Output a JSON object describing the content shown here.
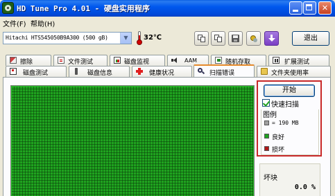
{
  "window": {
    "title": "HD Tune Pro 4.01 - 硬盘实用程序",
    "minimize_label": "_",
    "maximize_label": "□",
    "close_label": "✕"
  },
  "menu": {
    "items": [
      {
        "label": "文件(F)"
      },
      {
        "label": "帮助(H)"
      }
    ]
  },
  "toolbar": {
    "drive": "Hitachi HTS545050B9A300 (500 gB)",
    "temperature": "32℃",
    "exit_label": "退出",
    "buttons": [
      "copy-text-icon",
      "copy-screenshot-icon",
      "save-icon",
      "options-icon",
      "download-icon"
    ]
  },
  "tabs": {
    "row1": [
      {
        "label": "擦除",
        "icon": "erase-icon"
      },
      {
        "label": "文件测试",
        "icon": "file-test-icon"
      },
      {
        "label": "磁盘监视",
        "icon": "disk-monitor-icon"
      },
      {
        "label": "AAM",
        "icon": "speaker-icon"
      },
      {
        "label": "随机存取",
        "icon": "random-access-icon"
      },
      {
        "label": "扩展测试",
        "icon": "extra-tests-icon"
      }
    ],
    "row2": [
      {
        "label": "磁盘测试",
        "icon": "benchmark-icon"
      },
      {
        "label": "磁盘信息",
        "icon": "info-icon"
      },
      {
        "label": "健康状况",
        "icon": "health-cross-icon"
      },
      {
        "label": "扫描错误",
        "icon": "magnifier-icon",
        "active": true
      },
      {
        "label": "文件夹使用率",
        "icon": "folder-icon"
      }
    ]
  },
  "scan": {
    "start_label": "开始",
    "quick_scan_label": "快速扫描",
    "quick_scan_checked": true,
    "legend_title": "图例",
    "legend": [
      {
        "label": "= 190 MB",
        "color": "#a0a0a0"
      },
      {
        "label": "良好",
        "color": "#1fa31f"
      },
      {
        "label": "损坏",
        "color": "#b01818"
      }
    ],
    "damaged_title": "坏块",
    "damaged_value": "0.0 %"
  },
  "colors": {
    "title_bar": "#0058ee",
    "block_good": "#1fa31f",
    "highlight_border": "#c82828",
    "active_tab_accent": "#e68b2c"
  }
}
